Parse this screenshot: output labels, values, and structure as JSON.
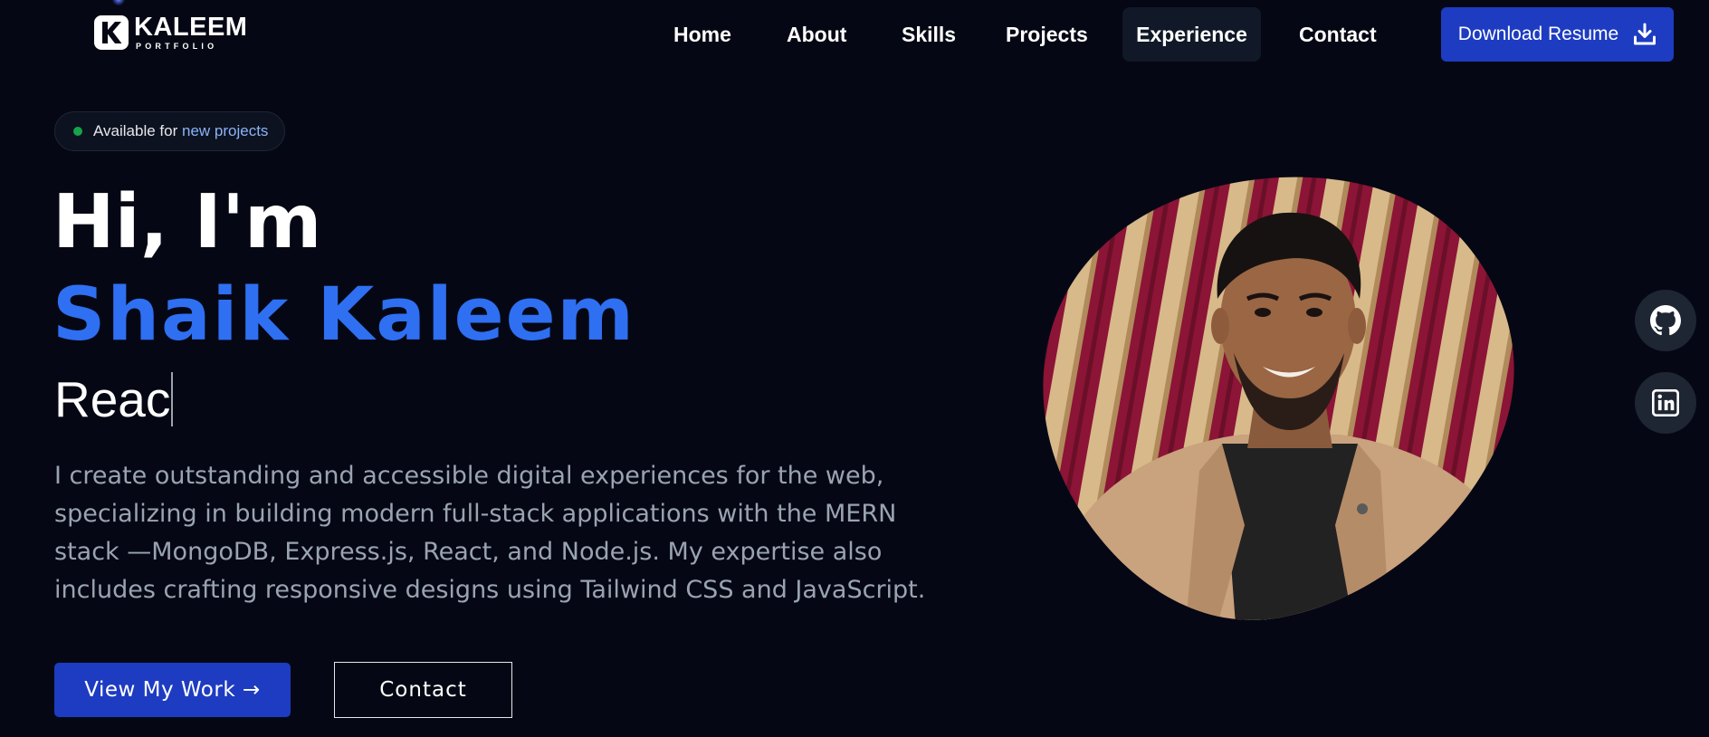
{
  "logo": {
    "mark": "K",
    "title": "KALEEM",
    "subtitle": "PORTFOLIO"
  },
  "nav": {
    "items": [
      {
        "label": "Home"
      },
      {
        "label": "About"
      },
      {
        "label": "Skills"
      },
      {
        "label": "Projects"
      },
      {
        "label": "Experience",
        "active": true
      },
      {
        "label": "Contact"
      }
    ],
    "resume_label": "Download Resume",
    "resume_icon": "download-icon"
  },
  "hero": {
    "badge": {
      "prefix": "Available for",
      "highlight": "new projects"
    },
    "greeting": "Hi, I'm",
    "name": "Shaik Kaleem",
    "typed_text": "Reac",
    "description": "I create outstanding and accessible digital experiences for the web, specializing in building modern full-stack applications with the MERN stack —MongoDB, Express.js, React, and Node.js. My expertise also includes crafting responsive designs using Tailwind CSS and JavaScript.",
    "primary_button": "View My Work →",
    "secondary_button": "Contact"
  },
  "social": [
    {
      "name": "github-icon"
    },
    {
      "name": "linkedin-icon"
    }
  ],
  "colors": {
    "background": "#050814",
    "accent_blue": "#2f6ff2",
    "button_blue": "#1d3cc1",
    "status_green": "#16a34a",
    "muted_text": "#9aa3b2"
  }
}
